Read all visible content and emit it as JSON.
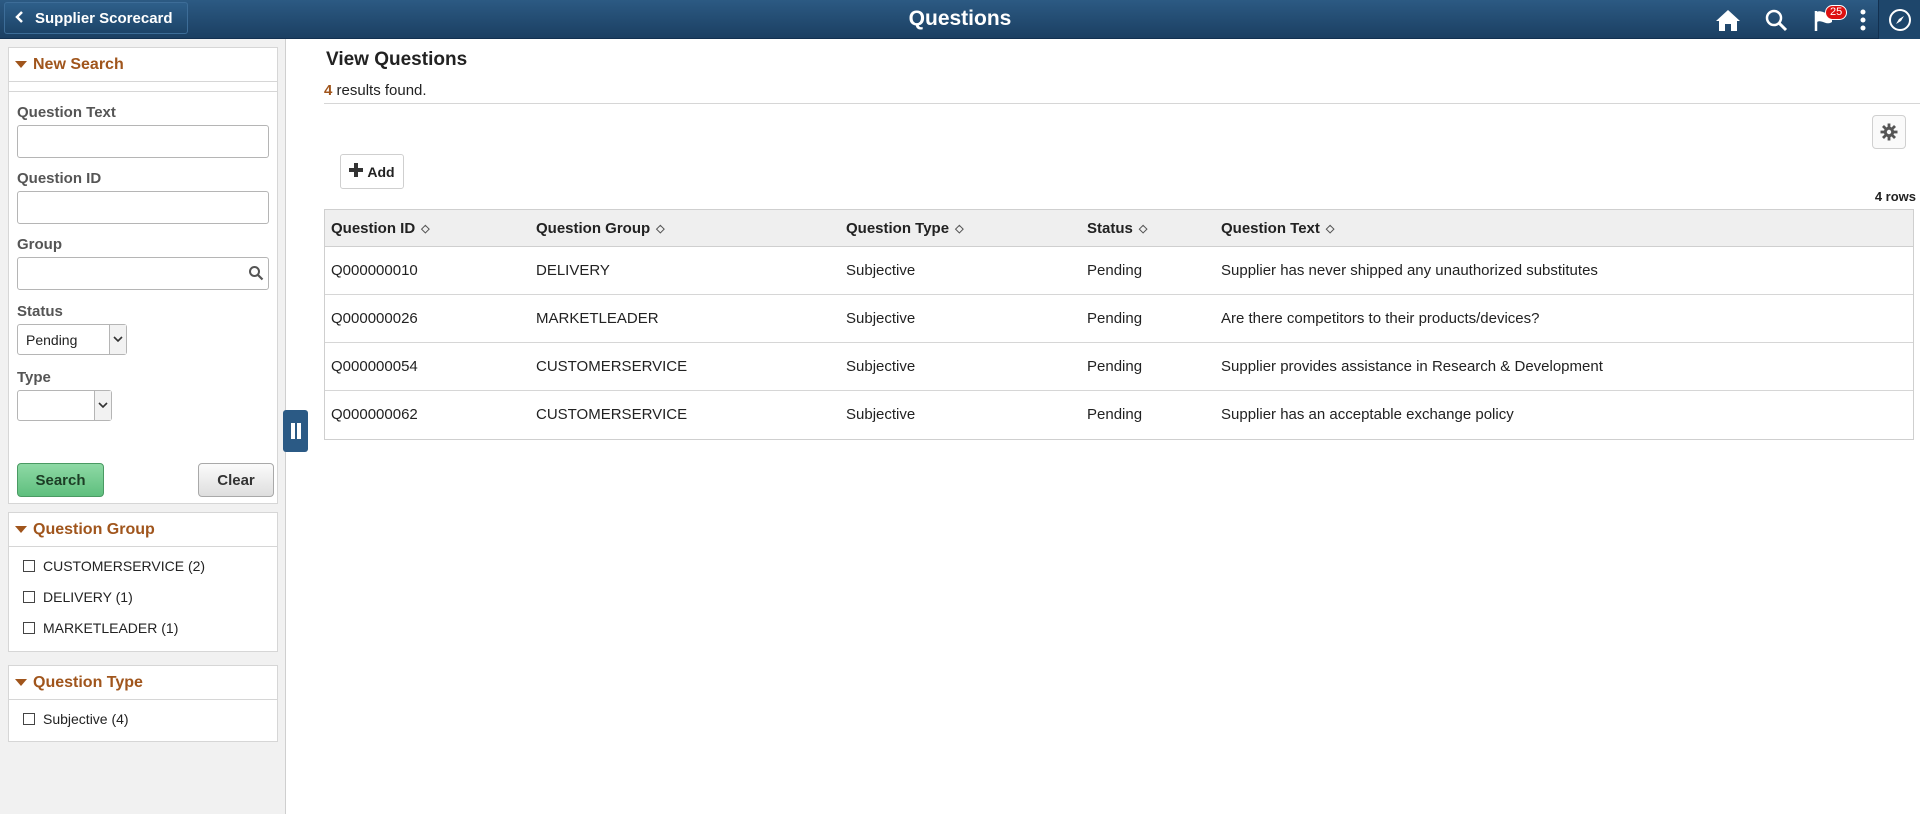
{
  "header": {
    "back_label": "Supplier Scorecard",
    "title": "Questions",
    "notification_count": "25"
  },
  "search": {
    "title": "New Search",
    "question_text_label": "Question Text",
    "question_id_label": "Question ID",
    "group_label": "Group",
    "status_label": "Status",
    "status_value": "Pending",
    "type_label": "Type",
    "type_value": "",
    "search_label": "Search",
    "clear_label": "Clear"
  },
  "facets": {
    "group_title": "Question Group",
    "group_items": [
      "CUSTOMERSERVICE (2)",
      "DELIVERY (1)",
      "MARKETLEADER (1)"
    ],
    "type_title": "Question Type",
    "type_items": [
      "Subjective (4)"
    ]
  },
  "main": {
    "title": "View Questions",
    "result_count": "4",
    "result_suffix": "results found.",
    "add_label": "Add",
    "rows_label": "4 rows"
  },
  "table": {
    "columns": [
      "Question ID",
      "Question Group",
      "Question Type",
      "Status",
      "Question Text"
    ],
    "rows": [
      [
        "Q000000010",
        "DELIVERY",
        "Subjective",
        "Pending",
        "Supplier has never shipped any unauthorized substitutes"
      ],
      [
        "Q000000026",
        "MARKETLEADER",
        "Subjective",
        "Pending",
        "Are there competitors to their products/devices?"
      ],
      [
        "Q000000054",
        "CUSTOMERSERVICE",
        "Subjective",
        "Pending",
        "Supplier provides assistance in Research & Development"
      ],
      [
        "Q000000062",
        "CUSTOMERSERVICE",
        "Subjective",
        "Pending",
        "Supplier has an acceptable exchange policy"
      ]
    ]
  },
  "colors": {
    "header_bg": "#1f4a72",
    "accent": "#a0551c",
    "search_btn": "#6cc68a"
  }
}
